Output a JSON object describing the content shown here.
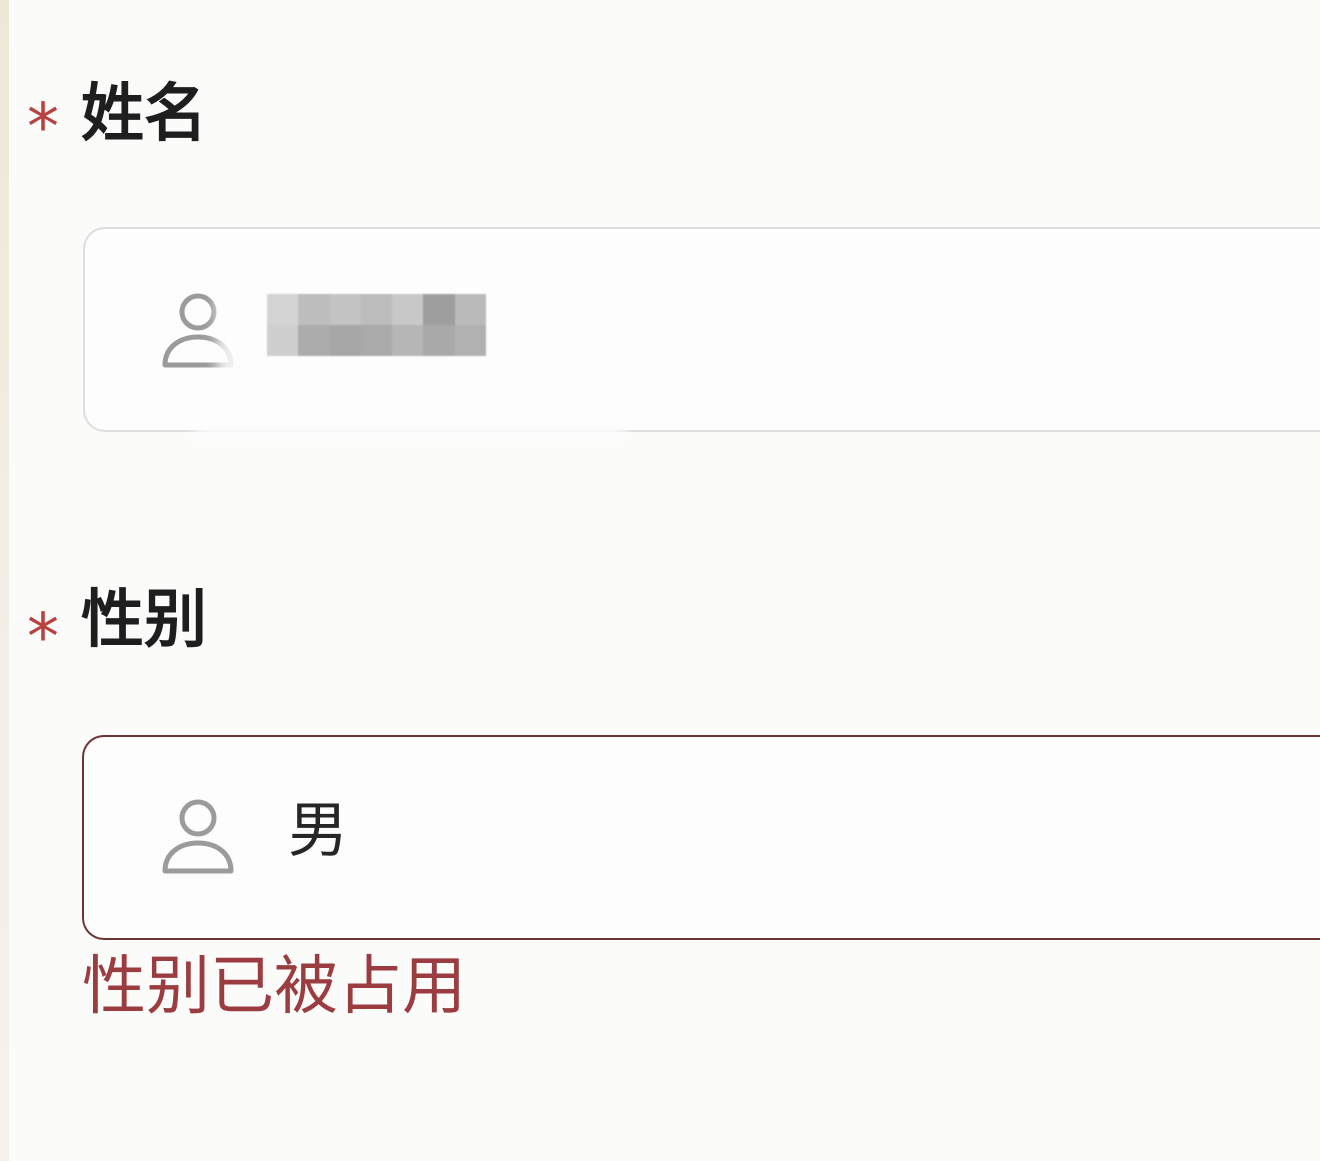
{
  "form": {
    "fields": [
      {
        "required_mark": "*",
        "label": "姓名",
        "icon": "person-icon"
      },
      {
        "required_mark": "*",
        "label": "性别",
        "icon": "person-icon",
        "value": "男",
        "error": "性别已被占用"
      }
    ]
  },
  "theme": {
    "required_color": "#b8423f",
    "error_color": "#9b3c40",
    "error_border_color": "#6e3537",
    "icon_color": "#9b9b9b",
    "input_border_color": "#dedede",
    "text_color": "#1e1e1e"
  }
}
